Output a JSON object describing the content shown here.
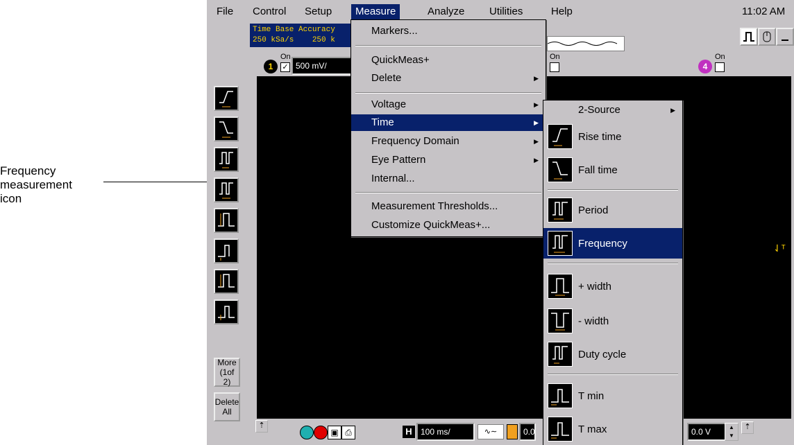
{
  "callout": {
    "line1": "Frequency",
    "line2": "measurement",
    "line3": "icon"
  },
  "menubar": {
    "items": [
      "File",
      "Control",
      "Setup",
      "Measure",
      "Analyze",
      "Utilities",
      "Help"
    ],
    "active": "Measure",
    "clock": "11:02 AM"
  },
  "status": {
    "line1": "Time Base Accuracy",
    "line2": "250 kSa/s    250 k"
  },
  "channels": {
    "ch1": {
      "number": "1",
      "on": "On",
      "scale": "500 mV/"
    },
    "ch3": {
      "on": "On"
    },
    "ch4": {
      "number": "4",
      "on": "On"
    }
  },
  "left_toolbar": {
    "icons": [
      "rise-time-icon",
      "fall-time-icon",
      "period-icon",
      "frequency-icon",
      "plus-width-icon",
      "minus-width-icon",
      "duty-cycle-icon",
      "t-min-icon"
    ],
    "more": {
      "line1": "More",
      "line2": "(1of 2)"
    },
    "delete_all": {
      "line1": "Delete",
      "line2": "All"
    }
  },
  "measure_menu": {
    "items": [
      "Markers...",
      "QuickMeas+",
      "Delete",
      "Voltage",
      "Time",
      "Frequency Domain",
      "Eye Pattern",
      "Internal...",
      "Measurement Thresholds...",
      "Customize QuickMeas+..."
    ],
    "selected": "Time"
  },
  "time_submenu": {
    "header": "2-Source",
    "items": [
      "Rise time",
      "Fall time",
      "Period",
      "Frequency",
      "+ width",
      "- width",
      "Duty cycle",
      "T min",
      "T max"
    ],
    "selected": "Frequency"
  },
  "bottom_bar": {
    "h_label": "H",
    "timebase": "100 ms/",
    "position_partial": "0.0",
    "trigger_level": "0.0 V"
  },
  "colors": {
    "menu_bg": "#c6c3c6",
    "selection": "#08216b",
    "trace_orange": "#f0a020",
    "scope_bg": "#000000"
  }
}
